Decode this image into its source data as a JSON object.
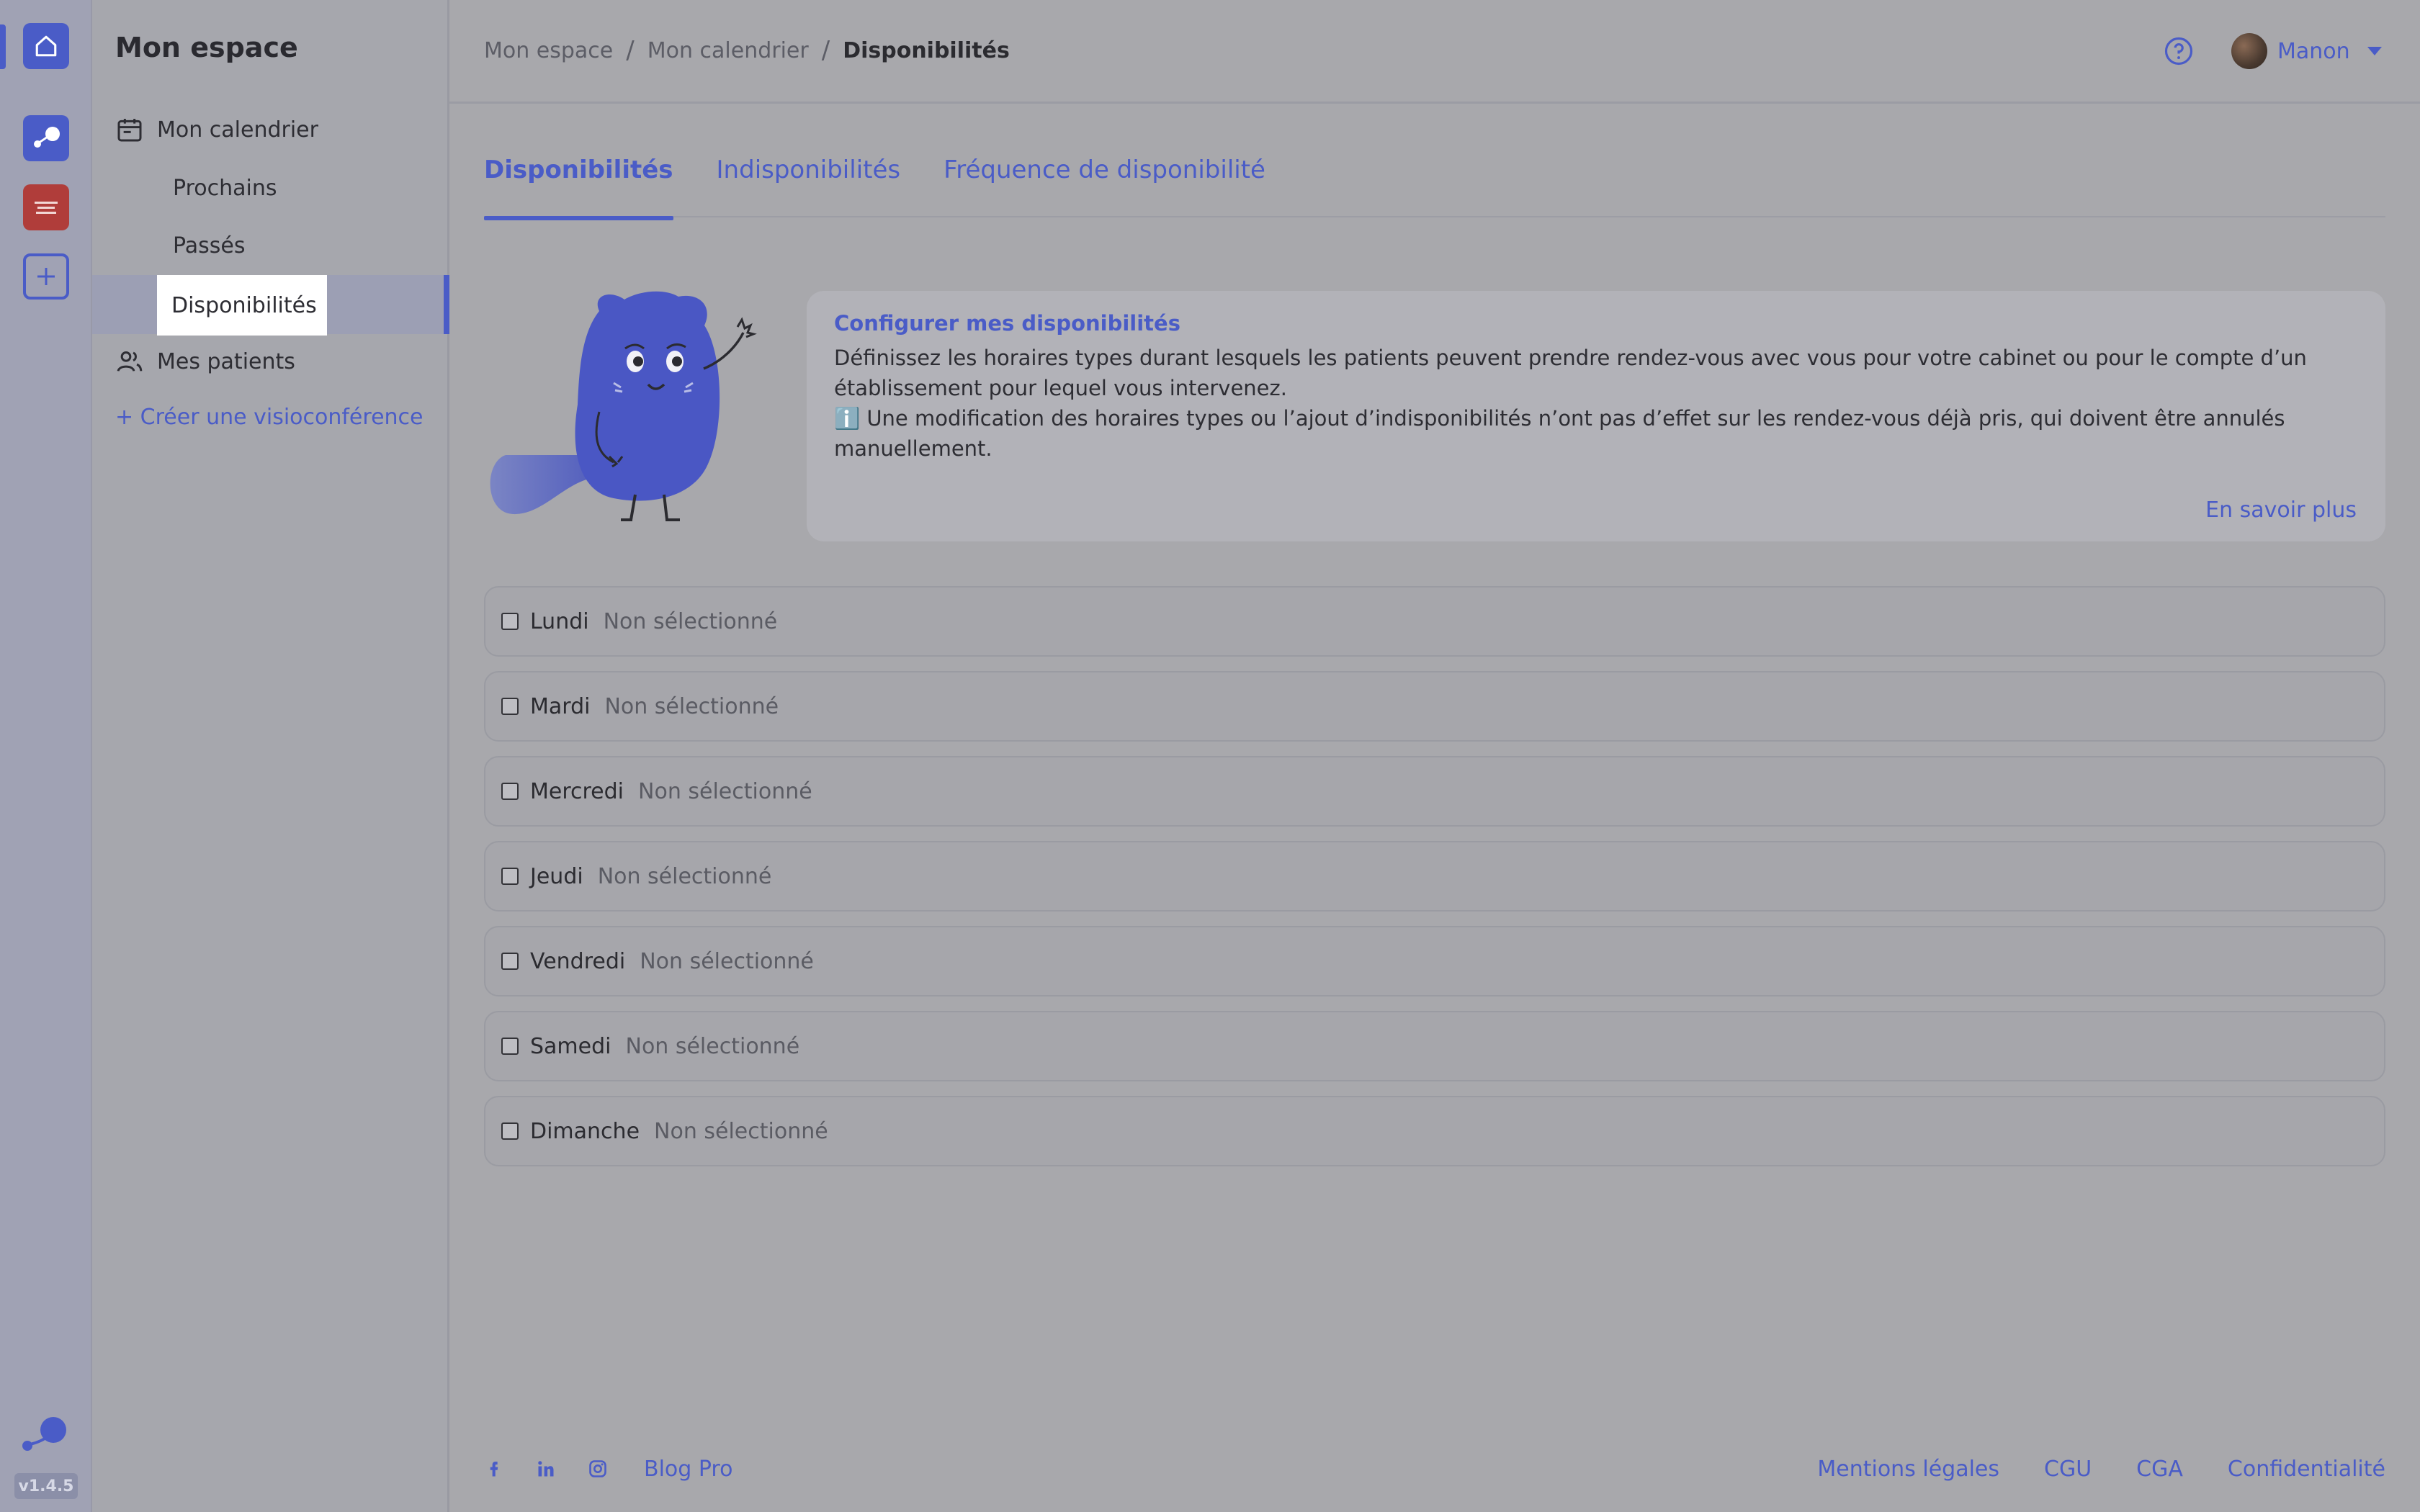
{
  "rail": {
    "version": "v1.4.5",
    "icons": [
      "home-icon",
      "app-bo-icon",
      "app-sante-icon",
      "plus-icon",
      "bo-logo-icon"
    ],
    "accent": "#4a5cc7"
  },
  "sidebar": {
    "title": "Mon espace",
    "calendar_label": "Mon calendrier",
    "sub_items": [
      "Prochains",
      "Passés",
      "Disponibilités"
    ],
    "patients_label": "Mes patients",
    "create_link": "+ Créer une visioconférence"
  },
  "header": {
    "breadcrumb": [
      "Mon espace",
      "Mon calendrier",
      "Disponibilités"
    ],
    "separator": "/",
    "user_name": "Manon"
  },
  "tabs": [
    "Disponibilités",
    "Indisponibilités",
    "Fréquence de disponibilité"
  ],
  "info": {
    "title": "Configurer mes disponibilités",
    "text1": "Définissez les horaires types durant lesquels les patients peuvent prendre rendez-vous avec vous pour votre cabinet ou pour le compte d’un établissement pour lequel vous intervenez.",
    "text2": "Une modification des horaires types ou l’ajout d’indisponibilités n’ont pas d’effet sur les rendez-vous déjà pris, qui doivent être annulés manuellement.",
    "info_glyph": "ℹ️",
    "link": "En savoir plus"
  },
  "days": [
    {
      "name": "Lundi",
      "status": "Non sélectionné"
    },
    {
      "name": "Mardi",
      "status": "Non sélectionné"
    },
    {
      "name": "Mercredi",
      "status": "Non sélectionné"
    },
    {
      "name": "Jeudi",
      "status": "Non sélectionné"
    },
    {
      "name": "Vendredi",
      "status": "Non sélectionné"
    },
    {
      "name": "Samedi",
      "status": "Non sélectionné"
    },
    {
      "name": "Dimanche",
      "status": "Non sélectionné"
    }
  ],
  "footer": {
    "social": [
      "facebook-icon",
      "linkedin-icon",
      "instagram-icon"
    ],
    "blog": "Blog Pro",
    "legal": [
      "Mentions légales",
      "CGU",
      "CGA",
      "Confidentialité"
    ]
  }
}
